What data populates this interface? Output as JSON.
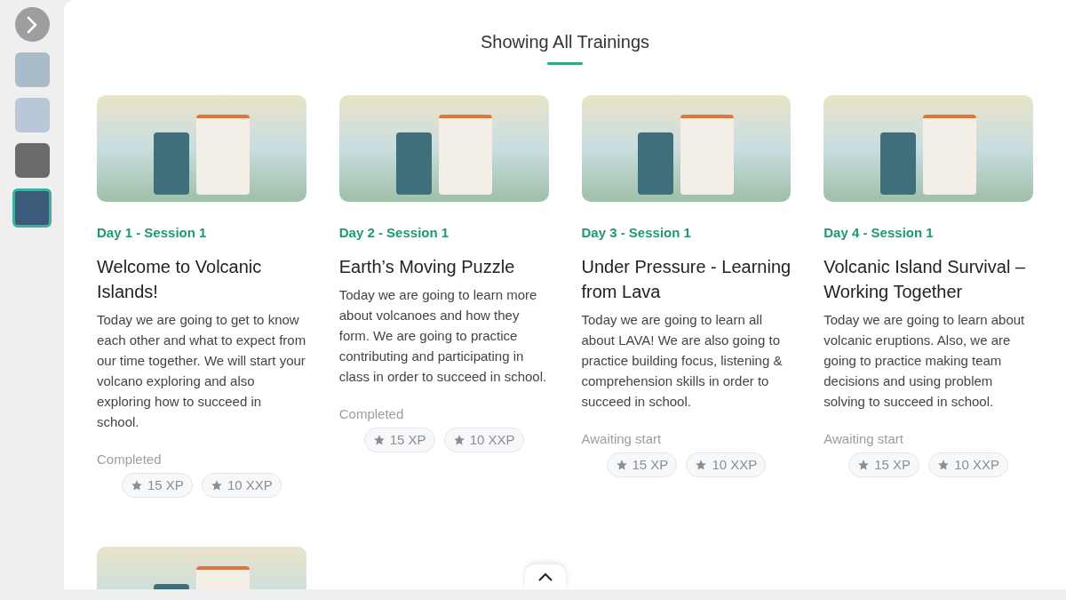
{
  "sidebar": {
    "thumbnails": [
      {
        "selected": false,
        "color": "#a9bcc9"
      },
      {
        "selected": false,
        "color": "#b9c7d8"
      },
      {
        "selected": false,
        "color": "#6b6b6b"
      },
      {
        "selected": true,
        "color": "#3c5a7a"
      }
    ]
  },
  "heading": "Showing All Trainings",
  "trainings": [
    {
      "kind": "session",
      "day": "Day 1 - Session 1",
      "title": "Welcome to Volcanic Islands!",
      "description": "Today we are going to get to know each other and what to expect from our time together.  We will start your volcano exploring and also exploring how to succeed in school.",
      "status": "Completed",
      "rewards": [
        "15 XP",
        "10 XXP"
      ]
    },
    {
      "kind": "session",
      "day": "Day 2 - Session 1",
      "title": "Earth’s Moving Puzzle",
      "description": "Today we are going to learn more about volcanoes and how they form.  We are going to practice contributing and participating in class in order to succeed in school.",
      "status": "Completed",
      "rewards": [
        "15 XP",
        "10 XXP"
      ]
    },
    {
      "kind": "session",
      "day": "Day 3 - Session 1",
      "title": "Under Pressure - Learning from Lava",
      "description": "Today we are going to learn all about LAVA! We are also going to practice building focus, listening & comprehension skills in order to succeed in school.",
      "status": "Awaiting start",
      "rewards": [
        "15 XP",
        "10 XXP"
      ]
    },
    {
      "kind": "session",
      "day": "Day 4 - Session 1",
      "title": "Volcanic Island Survival – Working Together",
      "description": "Today we are going to learn about volcanic eruptions.  Also, we are going to practice making team decisions and using problem solving to succeed in school.",
      "status": "Awaiting start",
      "rewards": [
        "15 XP",
        "10 XXP"
      ]
    },
    {
      "kind": "cover_only"
    }
  ]
}
